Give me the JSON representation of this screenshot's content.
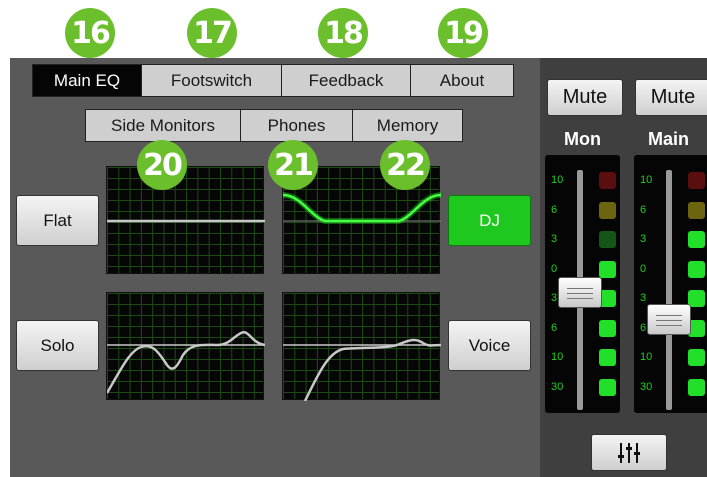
{
  "badges": [
    "16",
    "17",
    "18",
    "19",
    "20",
    "21",
    "22"
  ],
  "tabs_main": [
    {
      "label": "Main EQ",
      "active": true
    },
    {
      "label": "Footswitch",
      "active": false
    },
    {
      "label": "Feedback",
      "active": false
    },
    {
      "label": "About",
      "active": false
    }
  ],
  "tabs_sub": [
    {
      "label": "Side Monitors"
    },
    {
      "label": "Phones"
    },
    {
      "label": "Memory"
    }
  ],
  "presets": {
    "flat": "Flat",
    "dj": "DJ",
    "solo": "Solo",
    "voice": "Voice"
  },
  "channels": [
    {
      "mute_label": "Mute",
      "name": "Mon",
      "fader_level": 0.49
    },
    {
      "mute_label": "Mute",
      "name": "Main",
      "fader_level": 0.36
    }
  ],
  "meter_scale": [
    "10",
    "6",
    "3",
    "0",
    "3",
    "6",
    "10",
    "30"
  ],
  "meter_leds": {
    "Mon": [
      "off-red",
      "off-yellow",
      "off-green",
      "green",
      "green",
      "green",
      "green",
      "green"
    ],
    "Main": [
      "off-red",
      "off-yellow",
      "green",
      "green",
      "green",
      "green",
      "green",
      "green"
    ]
  },
  "colors": {
    "accent": "#1fc81f",
    "badge": "#6cbf2c",
    "panel": "#595959",
    "grid": "#1c4a14",
    "curve_active": "#22ff22",
    "curve": "#c8c8c8"
  },
  "icons": {
    "mixer": "mixer-sliders-icon"
  }
}
